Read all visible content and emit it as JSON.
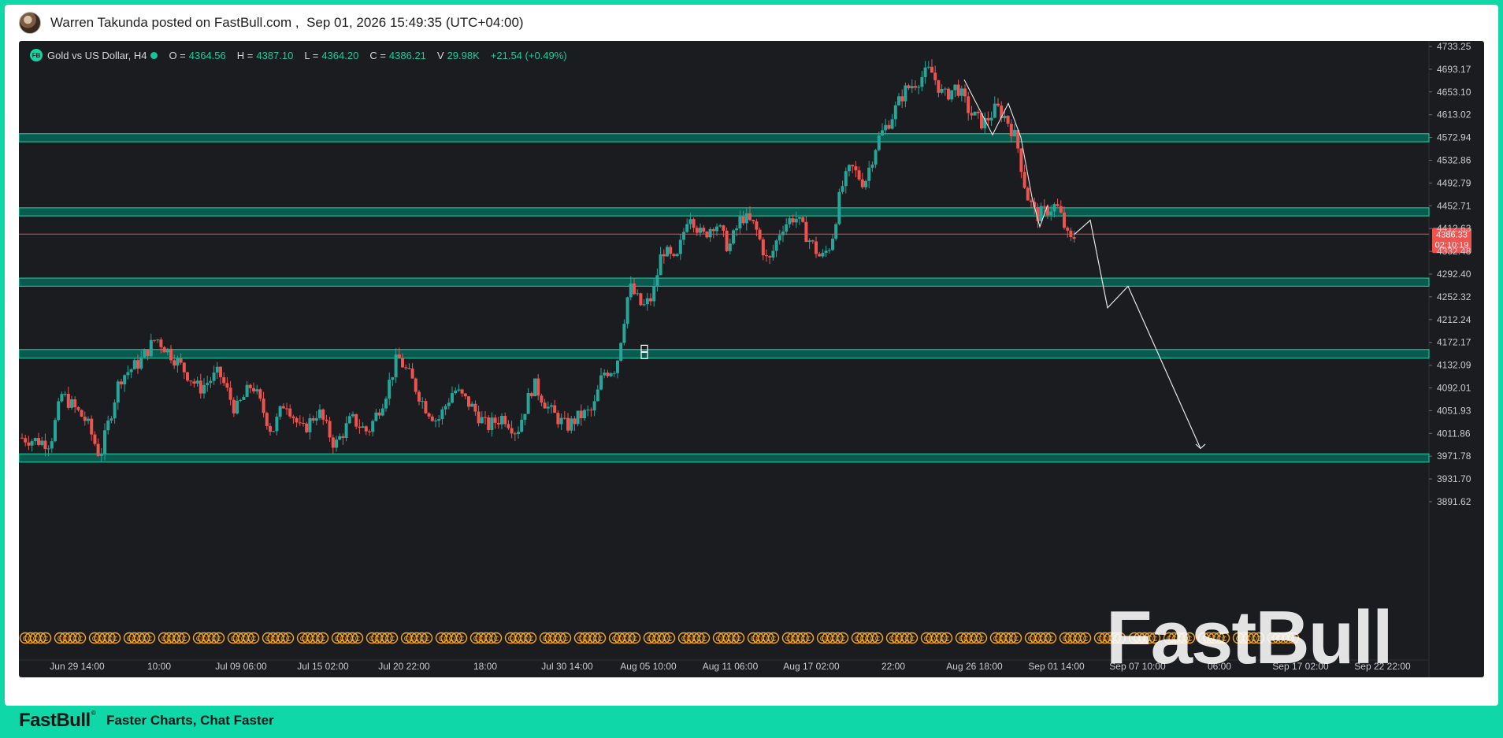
{
  "header": {
    "poster": "Warren Takunda posted on FastBull.com",
    "separator": " ,  ",
    "timestamp": "Sep 01, 2026 15:49:35 (UTC+04:00)"
  },
  "legend": {
    "icon_text": "FB",
    "symbol": "Gold vs US Dollar, H4",
    "open_label": "O =",
    "open": "4364.56",
    "high_label": "H =",
    "high": "4387.10",
    "low_label": "L =",
    "low": "4364.20",
    "close_label": "C =",
    "close": "4386.21",
    "volume_label": "V",
    "volume": "29.98K",
    "change": "+21.54 (+0.49%)"
  },
  "price_tag": {
    "price": "4386.33",
    "countdown": "02:10:19"
  },
  "watermark": "FastBull",
  "footer": {
    "logo": "FastBull",
    "tagline": "Faster Charts, Chat Faster"
  },
  "colors": {
    "up": "#26a69a",
    "down": "#ef5350",
    "zone_fill": "#0b5e52",
    "zone_border": "#18c79d",
    "price_line": "#e05050",
    "projection": "#e6e6e6",
    "event_markers": "#f5a623",
    "brand": "#0fd7a8"
  },
  "chart_data": {
    "type": "candlestick",
    "timeframe": "H4",
    "symbol": "Gold vs US Dollar",
    "ylim": [
      3860,
      4745
    ],
    "y_ticks": [
      "4733.25",
      "4693.17",
      "4653.10",
      "4613.02",
      "4572.94",
      "4532.86",
      "4492.79",
      "4452.71",
      "4412.63",
      "4332.48",
      "4292.40",
      "4252.32",
      "4212.24",
      "4172.17",
      "4132.09",
      "4092.01",
      "4051.93",
      "4011.86",
      "3971.78",
      "3931.70",
      "3891.62"
    ],
    "x_ticks": [
      "Jun 29 14:00",
      "10:00",
      "Jul 09 06:00",
      "Jul 15 02:00",
      "Jul 20 22:00",
      "18:00",
      "Jul 30 14:00",
      "Aug 05 10:00",
      "Aug 11 06:00",
      "Aug 17 02:00",
      "22:00",
      "Aug 26 18:00",
      "Sep 01 14:00",
      "Sep 07 10:00",
      "06:00",
      "Sep 17 02:00",
      "Sep 22 22:00"
    ],
    "last_price": 4386.33,
    "zones": [
      {
        "low": 4557,
        "high": 4572
      },
      {
        "low": 4420,
        "high": 4435
      },
      {
        "low": 4290,
        "high": 4305
      },
      {
        "low": 4157,
        "high": 4173
      },
      {
        "low": 3965,
        "high": 3980
      }
    ],
    "price_path": [
      [
        0,
        4010
      ],
      [
        18,
        4000
      ],
      [
        25,
        4090
      ],
      [
        40,
        4040
      ],
      [
        48,
        3975
      ],
      [
        60,
        4120
      ],
      [
        72,
        4150
      ],
      [
        82,
        4195
      ],
      [
        95,
        4150
      ],
      [
        108,
        4100
      ],
      [
        120,
        4130
      ],
      [
        130,
        4060
      ],
      [
        140,
        4110
      ],
      [
        152,
        4020
      ],
      [
        160,
        4080
      ],
      [
        170,
        4020
      ],
      [
        180,
        4060
      ],
      [
        190,
        3995
      ],
      [
        200,
        4045
      ],
      [
        210,
        4020
      ],
      [
        220,
        4085
      ],
      [
        228,
        4160
      ],
      [
        236,
        4120
      ],
      [
        244,
        4070
      ],
      [
        252,
        4040
      ],
      [
        262,
        4100
      ],
      [
        272,
        4070
      ],
      [
        282,
        4030
      ],
      [
        292,
        4050
      ],
      [
        300,
        4020
      ],
      [
        310,
        4110
      ],
      [
        320,
        4060
      ],
      [
        330,
        4030
      ],
      [
        338,
        4050
      ],
      [
        346,
        4060
      ],
      [
        352,
        4130
      ],
      [
        360,
        4140
      ],
      [
        368,
        4290
      ],
      [
        376,
        4250
      ],
      [
        382,
        4270
      ],
      [
        388,
        4360
      ],
      [
        396,
        4330
      ],
      [
        404,
        4430
      ],
      [
        412,
        4380
      ],
      [
        420,
        4410
      ],
      [
        428,
        4360
      ],
      [
        436,
        4420
      ],
      [
        444,
        4400
      ],
      [
        452,
        4330
      ],
      [
        460,
        4400
      ],
      [
        468,
        4420
      ],
      [
        476,
        4380
      ],
      [
        484,
        4340
      ],
      [
        490,
        4370
      ],
      [
        496,
        4470
      ],
      [
        502,
        4510
      ],
      [
        510,
        4480
      ],
      [
        518,
        4560
      ],
      [
        526,
        4600
      ],
      [
        534,
        4650
      ],
      [
        542,
        4670
      ],
      [
        550,
        4690
      ],
      [
        558,
        4640
      ],
      [
        566,
        4660
      ],
      [
        574,
        4610
      ],
      [
        582,
        4590
      ],
      [
        590,
        4620
      ],
      [
        596,
        4600
      ],
      [
        602,
        4560
      ],
      [
        608,
        4460
      ],
      [
        614,
        4420
      ],
      [
        620,
        4430
      ],
      [
        626,
        4440
      ],
      [
        630,
        4410
      ],
      [
        634,
        4370
      ],
      [
        638,
        4386
      ]
    ],
    "projection": [
      [
        4386.33,
        "Sep 01 14:00"
      ],
      [
        4410,
        "Sep 01"
      ],
      [
        4250,
        "Sep 04"
      ],
      [
        4290,
        "Sep 05"
      ],
      [
        3990,
        "Sep 09"
      ]
    ]
  }
}
